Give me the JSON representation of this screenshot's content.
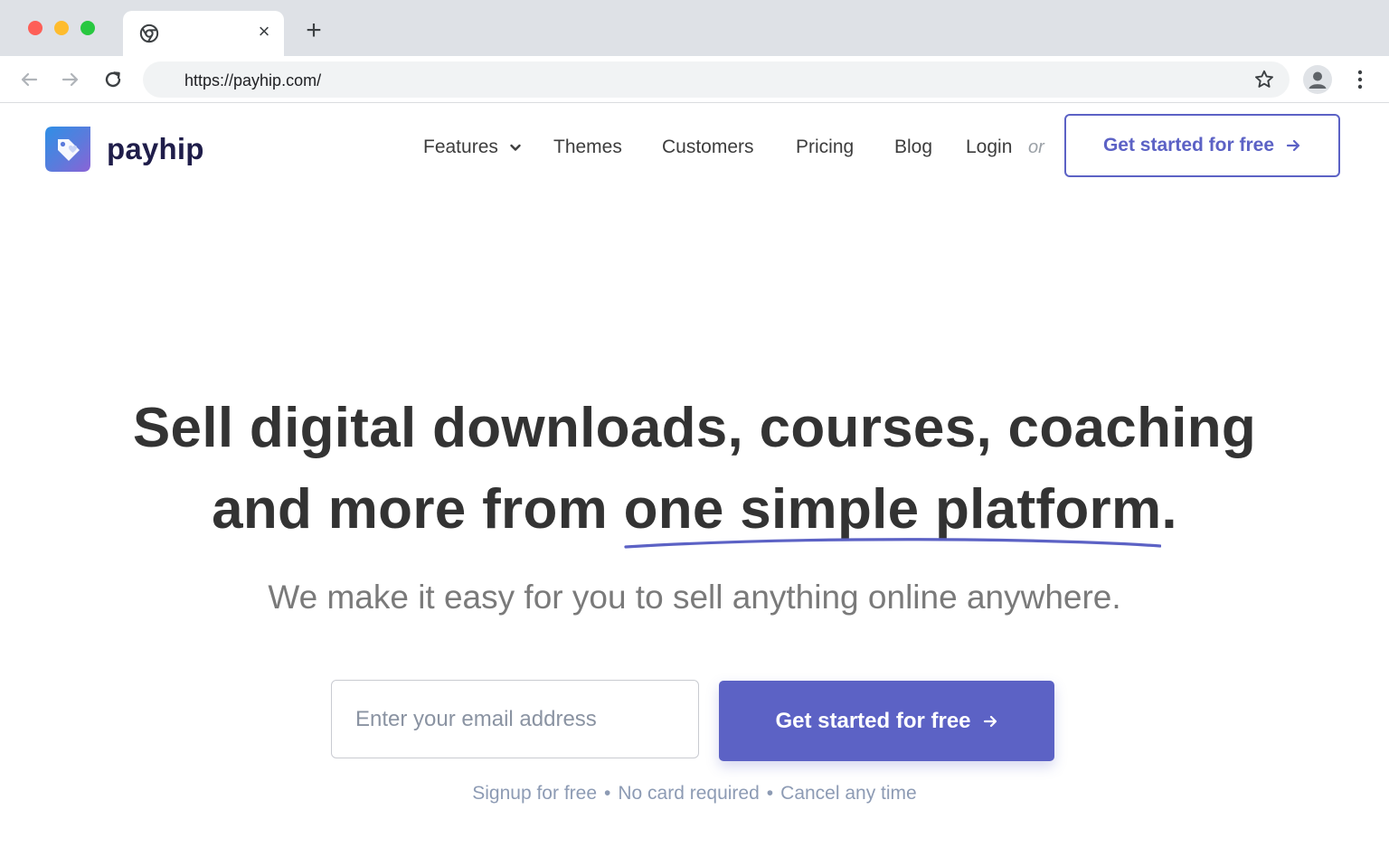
{
  "browser": {
    "tab": {
      "favicon": "chrome-icon",
      "close_label": "×"
    },
    "new_tab_label": "+",
    "url": "https://payhip.com/",
    "icons": [
      "back-arrow-icon",
      "forward-arrow-icon",
      "reload-icon",
      "star-icon",
      "profile-icon",
      "kebab-menu-icon"
    ]
  },
  "site": {
    "logo_text": "payhip",
    "nav": {
      "features": "Features",
      "themes": "Themes",
      "customers": "Customers",
      "pricing": "Pricing",
      "blog": "Blog",
      "login": "Login",
      "or": "or"
    },
    "header_cta": "Get started for free"
  },
  "hero": {
    "line1": "Sell digital downloads, courses, coaching",
    "line2_prefix": "and more from ",
    "line2_underlined": "one simple platform",
    "line2_suffix": ".",
    "subline": "We make it easy for you to sell anything online anywhere.",
    "email_placeholder": "Enter your email address",
    "cta": "Get started for free",
    "perks": [
      "Signup for free",
      "No card required",
      "Cancel any time"
    ],
    "perk_separator": "•"
  },
  "colors": {
    "accent": "#5c62c5",
    "heading": "#333333",
    "logo_text": "#1f1d4a",
    "perks": "#8d9bb4"
  }
}
